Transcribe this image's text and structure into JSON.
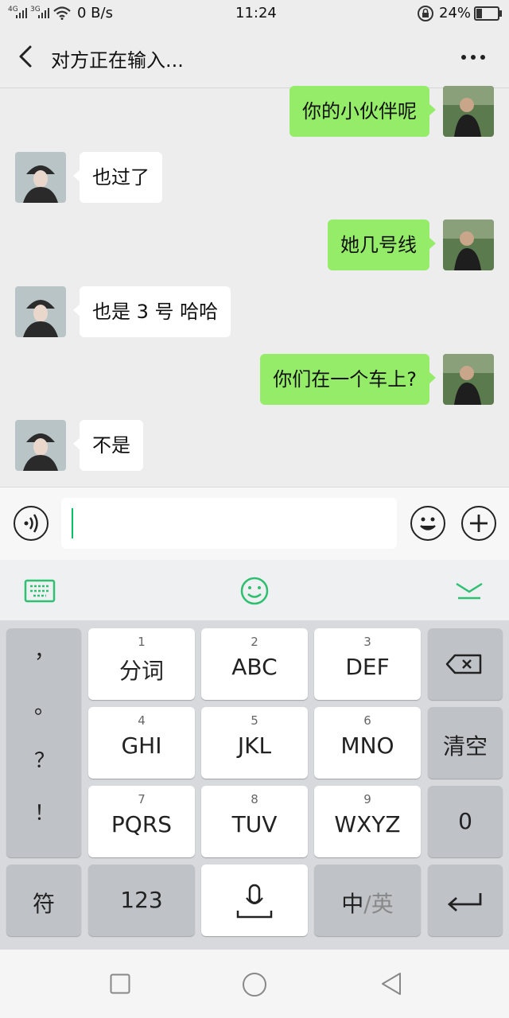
{
  "status_bar": {
    "network_left": "4G",
    "network_right": "3G",
    "speed": "0 B/s",
    "time": "11:24",
    "battery": "24%"
  },
  "header": {
    "title": "对方正在输入..."
  },
  "messages": [
    {
      "side": "mine",
      "text": "你的小伙伴呢"
    },
    {
      "side": "theirs",
      "text": "也过了"
    },
    {
      "side": "mine",
      "text": "她几号线"
    },
    {
      "side": "theirs",
      "text": "也是 3 号 哈哈"
    },
    {
      "side": "mine",
      "text": "你们在一个车上?"
    },
    {
      "side": "theirs",
      "text": "不是"
    }
  ],
  "input": {
    "value": "",
    "accent": "#07c160"
  },
  "keyboard": {
    "punctuation": [
      "，",
      "。",
      "？",
      "！"
    ],
    "keys": [
      {
        "num": "1",
        "label": "分词"
      },
      {
        "num": "2",
        "label": "ABC"
      },
      {
        "num": "3",
        "label": "DEF"
      },
      {
        "num": "4",
        "label": "GHI"
      },
      {
        "num": "5",
        "label": "JKL"
      },
      {
        "num": "6",
        "label": "MNO"
      },
      {
        "num": "7",
        "label": "PQRS"
      },
      {
        "num": "8",
        "label": "TUV"
      },
      {
        "num": "9",
        "label": "WXYZ"
      }
    ],
    "clear_label": "清空",
    "zero_label": "0",
    "symbol_label": "符",
    "numbers_label": "123",
    "lang_zh": "中",
    "lang_en": "/英"
  },
  "colors": {
    "bubble_mine": "#95ec69",
    "bubble_theirs": "#ffffff",
    "toolbar_green": "#2fbf71"
  }
}
